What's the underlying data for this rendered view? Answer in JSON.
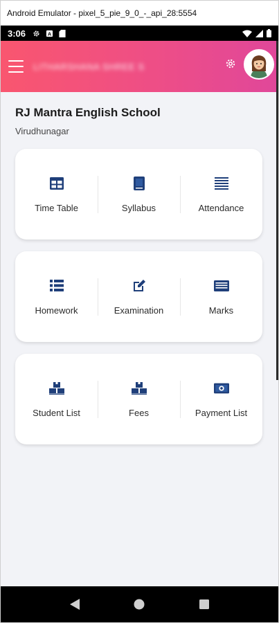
{
  "window": {
    "title": "Android Emulator - pixel_5_pie_9_0_-_api_28:5554"
  },
  "statusbar": {
    "time": "3:06"
  },
  "appbar": {
    "user_name": "LITHARSHANA SHREE S"
  },
  "school": {
    "name": "RJ Mantra English School",
    "city": "Virudhunagar"
  },
  "cards": [
    {
      "tiles": [
        {
          "label": "Time Table",
          "icon": "table-icon"
        },
        {
          "label": "Syllabus",
          "icon": "book-icon"
        },
        {
          "label": "Attendance",
          "icon": "list-lines-icon"
        }
      ]
    },
    {
      "tiles": [
        {
          "label": "Homework",
          "icon": "bulleted-list-icon"
        },
        {
          "label": "Examination",
          "icon": "edit-icon"
        },
        {
          "label": "Marks",
          "icon": "marks-sheet-icon"
        }
      ]
    },
    {
      "tiles": [
        {
          "label": "Student List",
          "icon": "boxes-icon"
        },
        {
          "label": "Fees",
          "icon": "boxes-icon"
        },
        {
          "label": "Payment List",
          "icon": "money-icon"
        }
      ]
    }
  ],
  "colors": {
    "accent_start": "#f9566f",
    "accent_end": "#e0479a",
    "icon": "#1f3f7a"
  }
}
